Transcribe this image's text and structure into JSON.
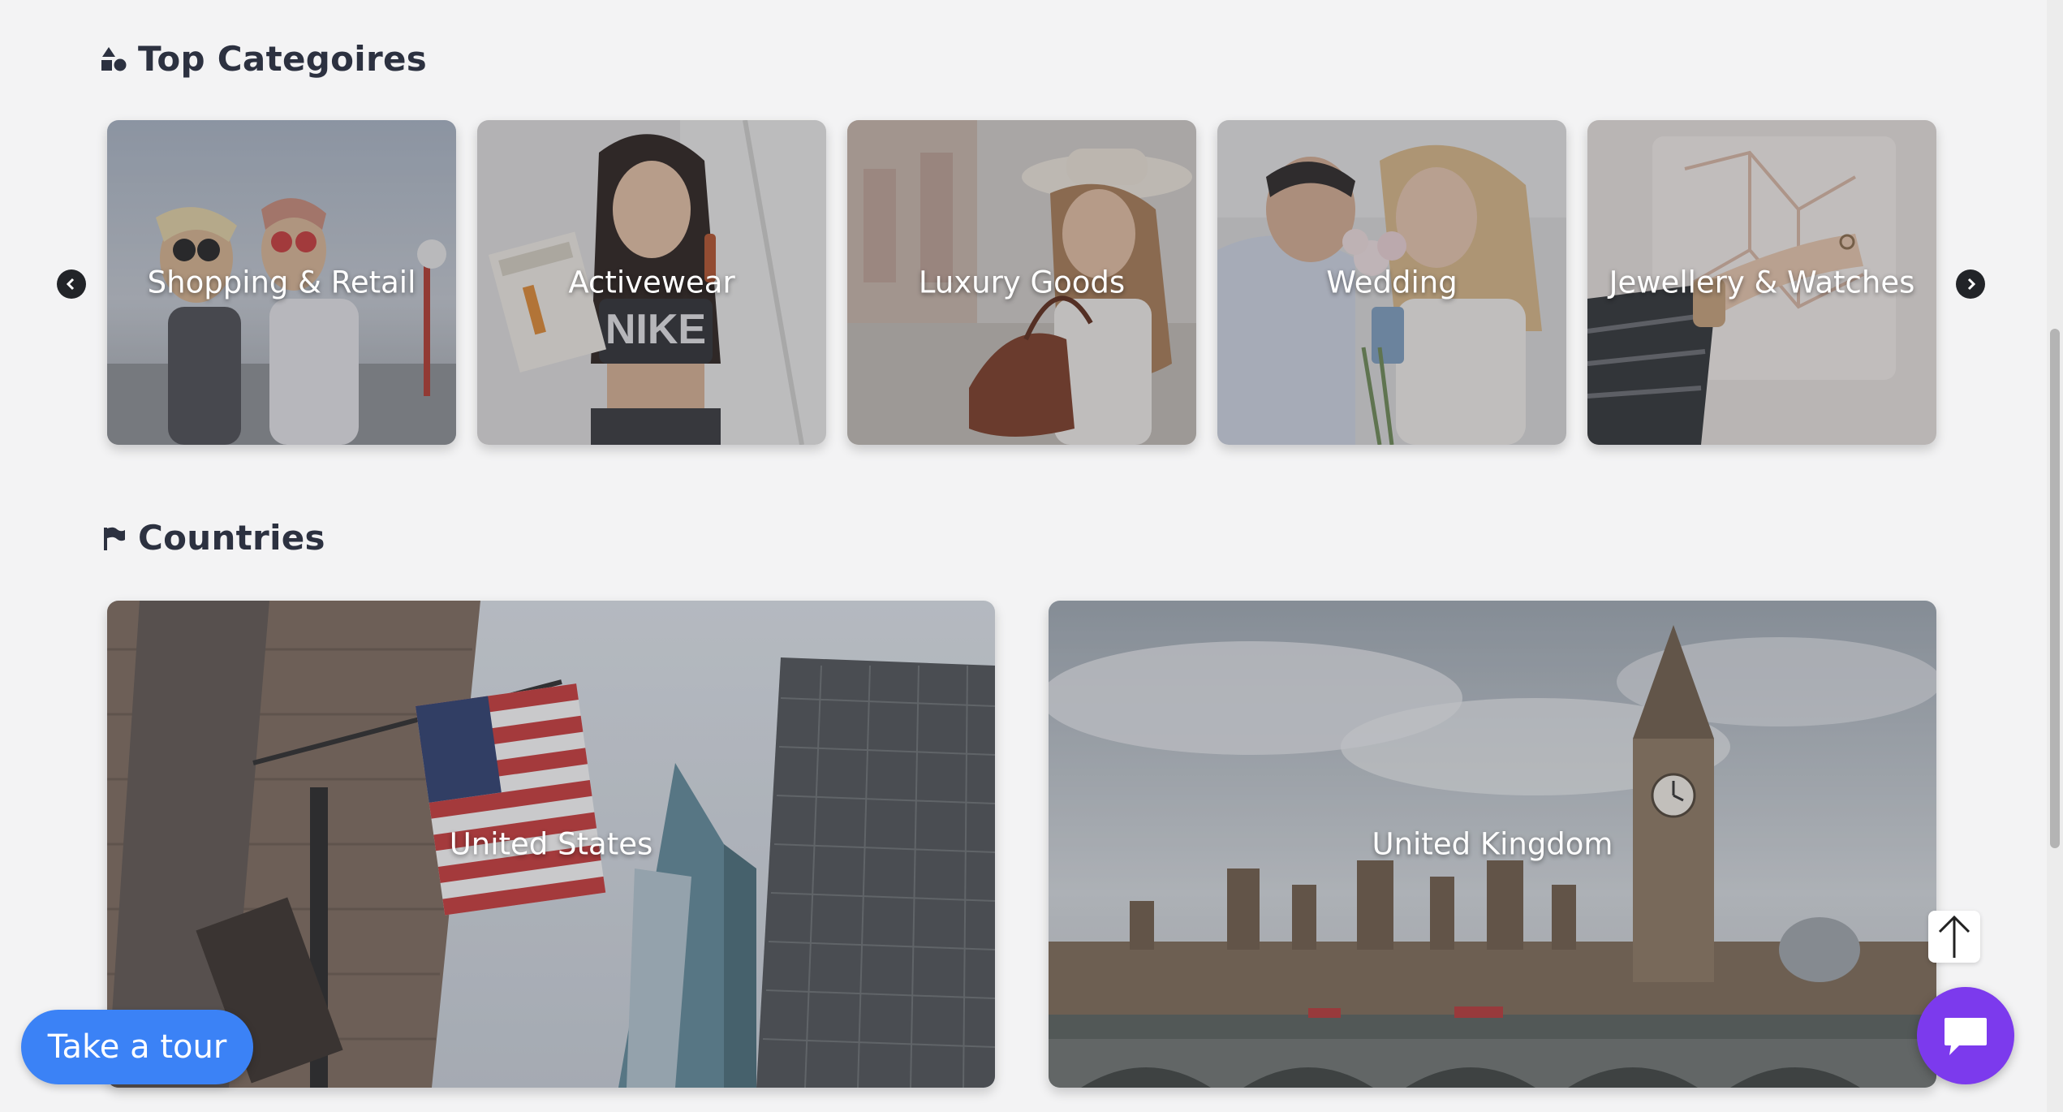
{
  "sections": {
    "categories_title": "Top Categoires",
    "countries_title": "Countries"
  },
  "categories": [
    {
      "label": "Shopping & Retail"
    },
    {
      "label": "Activewear"
    },
    {
      "label": "Luxury Goods"
    },
    {
      "label": "Wedding"
    },
    {
      "label": "Jewellery & Watches"
    }
  ],
  "countries": [
    {
      "label": "United States"
    },
    {
      "label": "United Kingdom"
    }
  ],
  "widgets": {
    "tour_label": "Take a tour"
  },
  "icons": {
    "categories": "shapes-icon",
    "countries": "flag-icon",
    "prev": "chevron-left-circle-icon",
    "next": "chevron-right-circle-icon",
    "scroll_top": "arrow-up-icon",
    "chat": "chat-bubble-icon"
  },
  "colors": {
    "heading": "#2c3140",
    "tour_button": "#3b82f6",
    "chat_button": "#7c3aed",
    "background": "#f3f3f4"
  }
}
